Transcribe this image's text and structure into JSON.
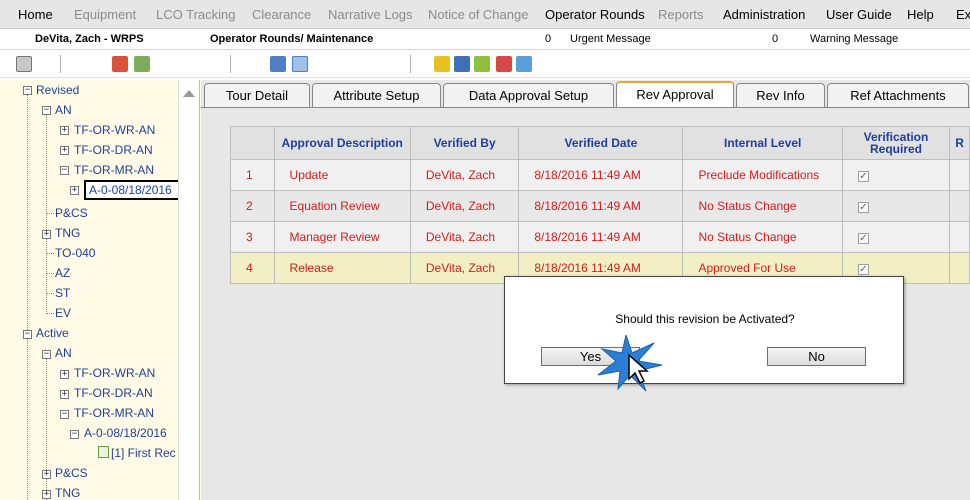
{
  "menu": [
    {
      "label": "Home",
      "enabled": true
    },
    {
      "label": "Equipment",
      "enabled": false
    },
    {
      "label": "LCO Tracking",
      "enabled": false
    },
    {
      "label": "Clearance",
      "enabled": false
    },
    {
      "label": "Narrative Logs",
      "enabled": false
    },
    {
      "label": "Notice of Change",
      "enabled": false
    },
    {
      "label": "Operator Rounds",
      "enabled": true
    },
    {
      "label": "Reports",
      "enabled": false
    },
    {
      "label": "Administration",
      "enabled": true
    },
    {
      "label": "User Guide",
      "enabled": true
    },
    {
      "label": "Help",
      "enabled": true
    },
    {
      "label": "Exi",
      "enabled": true
    }
  ],
  "infobar": {
    "user": "DeVita, Zach - WRPS",
    "module": "Operator Rounds/ Maintenance",
    "urgent_count": "0",
    "urgent_label": "Urgent Message",
    "warning_count": "0",
    "warning_label": "Warning Message"
  },
  "toolbar": {
    "icons": [
      "print-icon",
      "user-stamp-icon",
      "users-icon",
      "copy-icon",
      "document-icon",
      "key-icon",
      "checklist-icon",
      "export-icon",
      "edit-icon",
      "upload-icon"
    ]
  },
  "tree": {
    "nodes": [
      {
        "label": "Revised"
      },
      {
        "label": "AN"
      },
      {
        "label": "TF-OR-WR-AN"
      },
      {
        "label": "TF-OR-DR-AN"
      },
      {
        "label": "TF-OR-MR-AN"
      },
      {
        "label": "A-0-08/18/2016"
      },
      {
        "label": "P&CS"
      },
      {
        "label": "TNG"
      },
      {
        "label": "TO-040"
      },
      {
        "label": "AZ"
      },
      {
        "label": "ST"
      },
      {
        "label": "EV"
      },
      {
        "label": "Active"
      },
      {
        "label": "AN"
      },
      {
        "label": "TF-OR-WR-AN"
      },
      {
        "label": "TF-OR-DR-AN"
      },
      {
        "label": "TF-OR-MR-AN"
      },
      {
        "label": "A-0-08/18/2016"
      },
      {
        "label": "[1] First Rec"
      },
      {
        "label": "P&CS"
      },
      {
        "label": "TNG"
      }
    ]
  },
  "tabs": [
    {
      "label": "Tour Detail"
    },
    {
      "label": "Attribute Setup"
    },
    {
      "label": "Data Approval Setup"
    },
    {
      "label": "Rev Approval"
    },
    {
      "label": "Rev Info"
    },
    {
      "label": "Ref Attachments"
    }
  ],
  "active_tab": "Rev Approval",
  "table": {
    "headers": [
      "",
      "Approval Description",
      "Verified By",
      "Verified Date",
      "Internal Level",
      "Verification Required",
      "R"
    ],
    "rows": [
      {
        "num": "1",
        "description": "Update",
        "verified_by": "DeVita, Zach",
        "date": "8/18/2016 11:49 AM",
        "level": "Preclude Modifications",
        "required": true
      },
      {
        "num": "2",
        "description": "Equation Review",
        "verified_by": "DeVita, Zach",
        "date": "8/18/2016 11:49 AM",
        "level": "No Status Change",
        "required": true
      },
      {
        "num": "3",
        "description": "Manager Review",
        "verified_by": "DeVita, Zach",
        "date": "8/18/2016 11:49 AM",
        "level": "No Status Change",
        "required": true
      },
      {
        "num": "4",
        "description": "Release",
        "verified_by": "DeVita, Zach",
        "date": "8/18/2016 11:49 AM",
        "level": "Approved For Use",
        "required": true
      }
    ]
  },
  "dialog": {
    "message": "Should this revision be Activated?",
    "yes_label": "Yes",
    "no_label": "No"
  },
  "colors": {
    "tree_bg": "#fffbe6",
    "link_blue": "#1f3f9b",
    "row_red": "#d81b1b",
    "active_tab_accent": "#f3a333",
    "highlight_row": "#f2efc4"
  }
}
